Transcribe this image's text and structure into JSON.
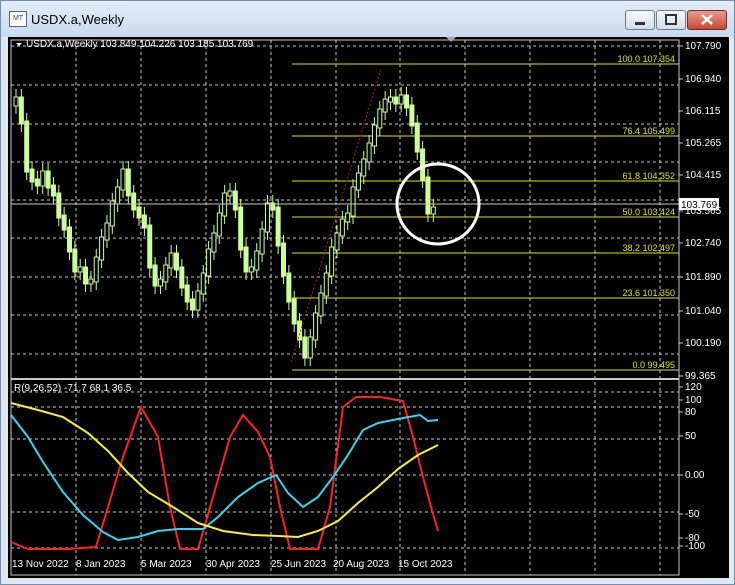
{
  "window": {
    "title": "USDX.a,Weekly",
    "app_icon_text": "MT"
  },
  "chart": {
    "header": "USDX.a,Weekly  103.849 104.226 103.185 103.769",
    "price_axis": [
      "107.790",
      "106.940",
      "106.115",
      "105.265",
      "104.415",
      "103.565",
      "102.740",
      "101.890",
      "101.040",
      "100.190",
      "99.365"
    ],
    "current_price": "103.769",
    "fib_levels": [
      {
        "label": "100.0  107.354"
      },
      {
        "label": "76.4  105.499"
      },
      {
        "label": "61.8  104.352"
      },
      {
        "label": "50.0  103.424"
      },
      {
        "label": "38.2  102.497"
      },
      {
        "label": "23.6  101.350"
      },
      {
        "label": "0.0  99.495"
      }
    ],
    "colors": {
      "background": "#000000",
      "grid": "#c8c8c8",
      "bull_candle": "#ccff99",
      "fib": "#e6e600",
      "current_line": "#ffffff",
      "highlight_circle": "#ffffff"
    }
  },
  "indicator": {
    "header": "R(9,26,52) -71.7 68.1 36.5",
    "axis": [
      "120",
      "100",
      "80",
      "50",
      "0.00",
      "-50",
      "-80",
      "-100"
    ],
    "colors": {
      "red": "#ff2020",
      "cyan": "#33d6f5",
      "yellow": "#ffee33"
    }
  },
  "time_axis": [
    "13 Nov 2022",
    "8 Jan 2023",
    "5 Mar 2023",
    "30 Apr 2023",
    "25 Jun 2023",
    "20 Aug 2023",
    "15 Oct 2023"
  ]
}
